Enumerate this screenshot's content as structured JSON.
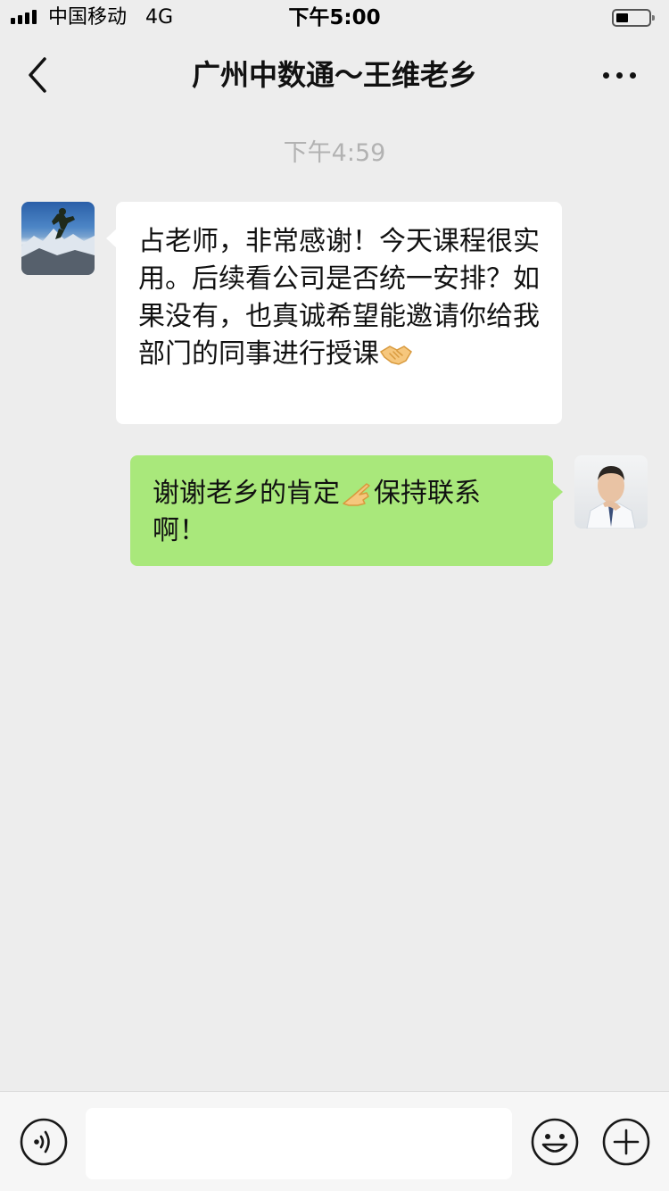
{
  "status_bar": {
    "carrier": "中国移动",
    "network": "4G",
    "time": "下午5:00",
    "battery_level": 0.3
  },
  "nav": {
    "title": "广州中数通～王维老乡",
    "back_icon": "chevron-left-icon",
    "more_icon": "more-dots-icon"
  },
  "chat": {
    "timestamp": "下午4:59",
    "messages": [
      {
        "side": "left",
        "text": "占老师，非常感谢！今天课程很实用。后续看公司是否统一安排？如果没有，也真诚希望能邀请你给我部门的同事进行授课",
        "emoji": "handshake-emoji",
        "bubble_color": "#ffffff"
      },
      {
        "side": "right",
        "text_before": "谢谢老乡的肯定",
        "emoji": "pointing-hand-emoji",
        "text_after": "保持联系啊！",
        "bubble_color": "#a9e87b"
      }
    ]
  },
  "input_bar": {
    "voice_icon": "voice-icon",
    "input_value": "",
    "emoji_icon": "smiley-icon",
    "plus_icon": "plus-circle-icon"
  },
  "colors": {
    "background": "#ededed",
    "own_bubble": "#a9e87b",
    "timestamp": "#b2b2b2"
  }
}
